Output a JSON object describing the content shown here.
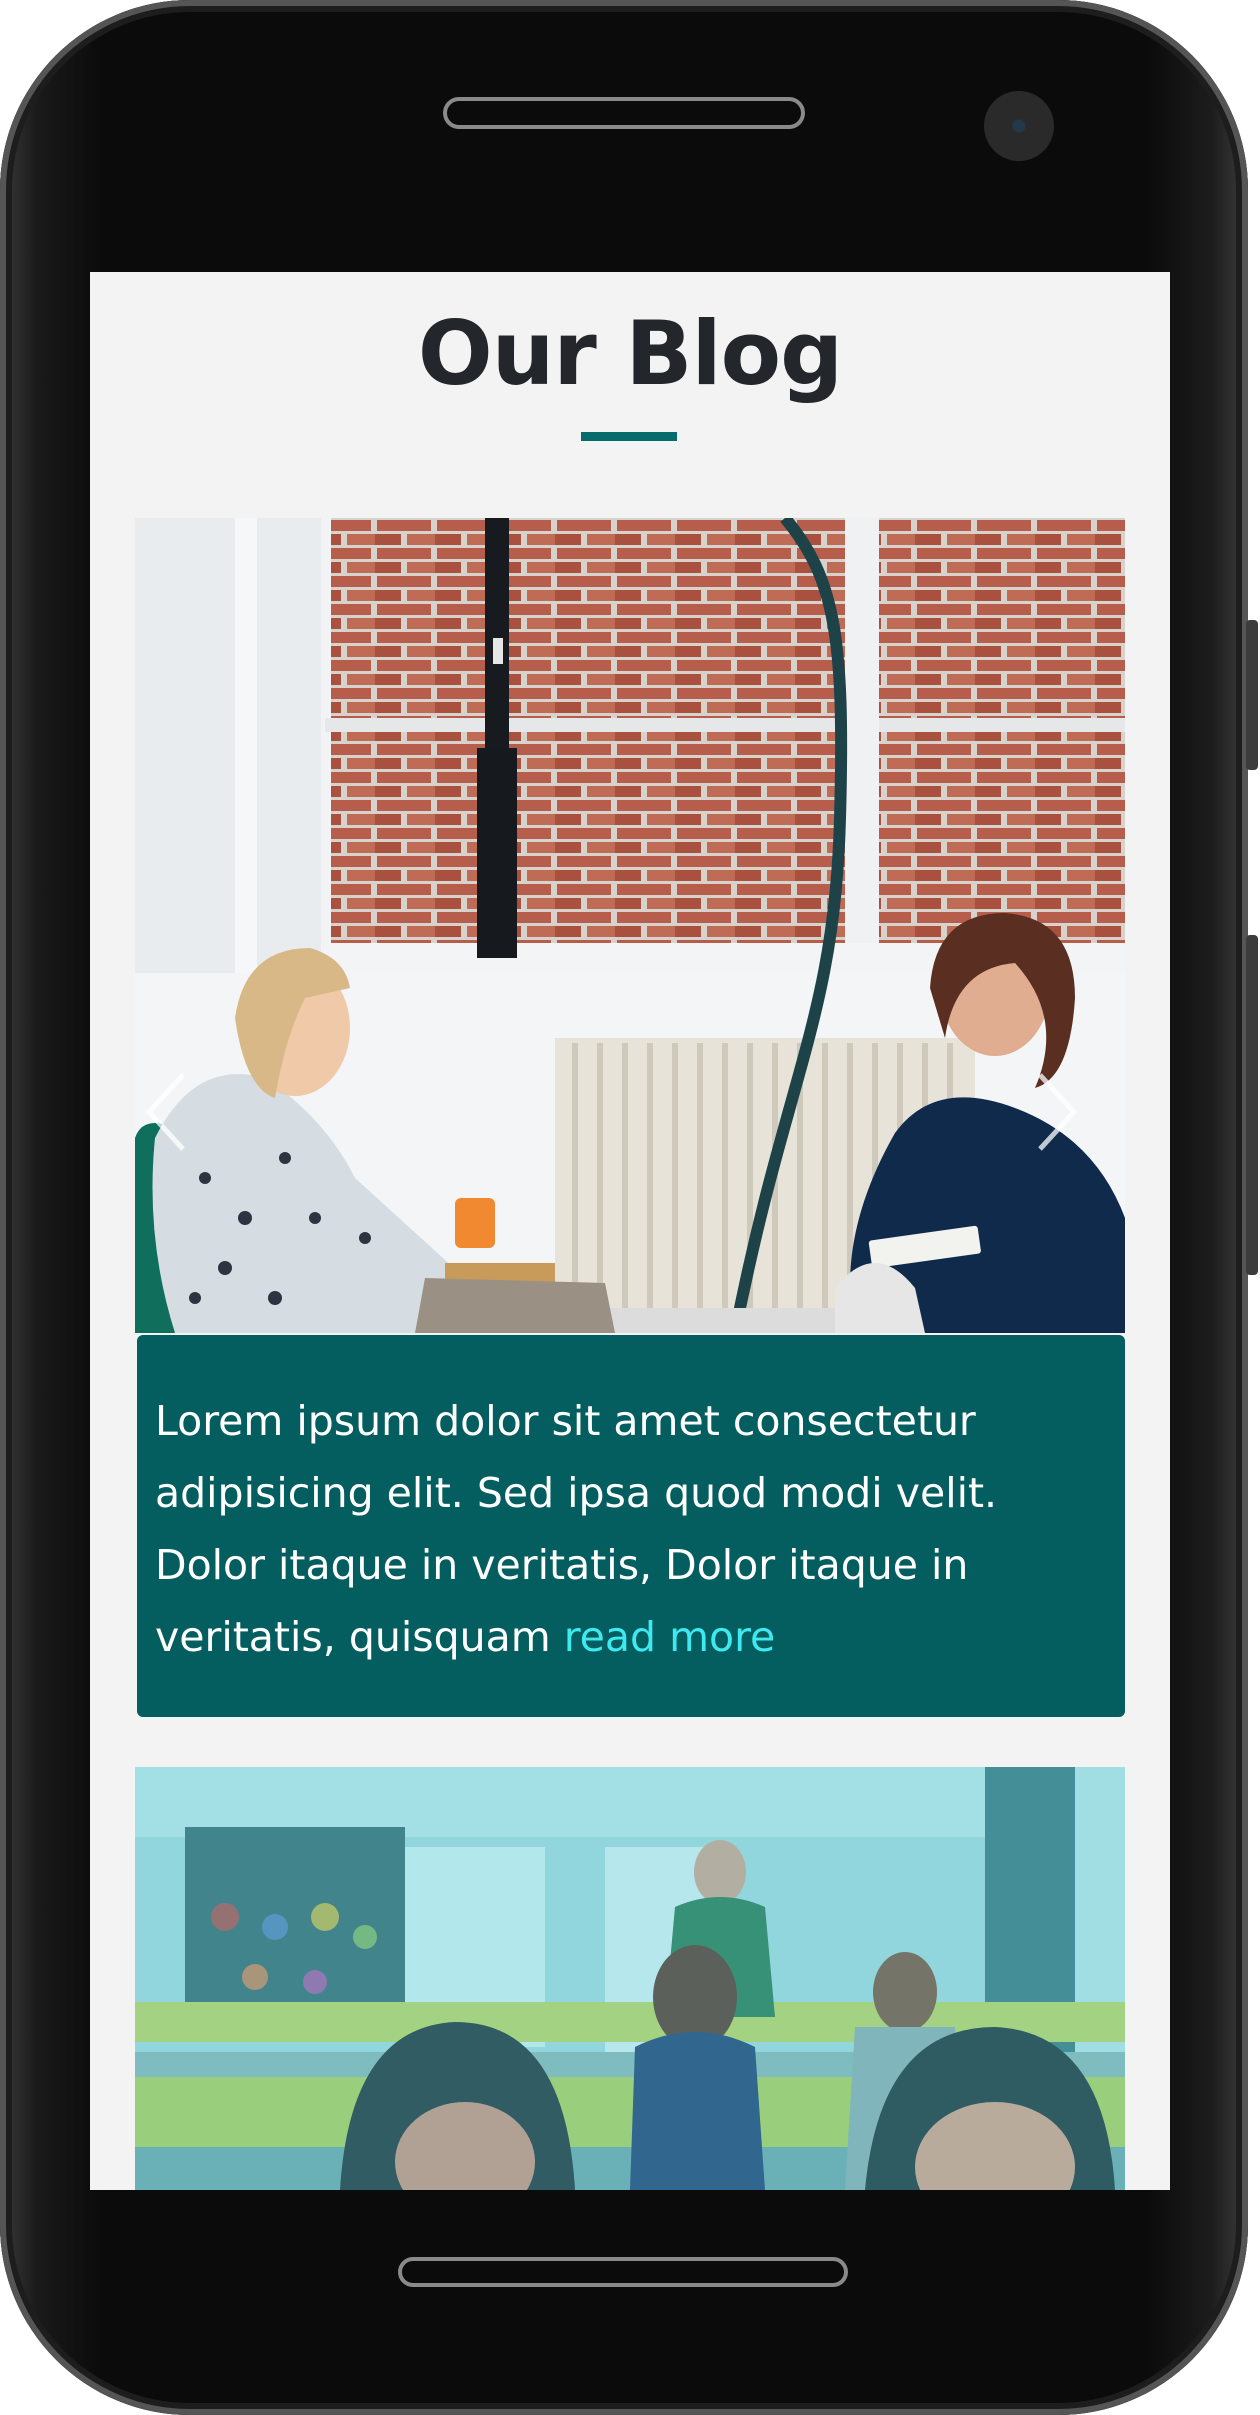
{
  "page": {
    "title": "Our Blog"
  },
  "posts": [
    {
      "image_label": "two women meeting by a brick window",
      "excerpt": "Lorem ipsum dolor sit amet consectetur adipisicing elit. Sed ipsa quod modi velit. Dolor itaque in veritatis, Dolor itaque in veritatis, quisquam ",
      "read_more": "read more"
    },
    {
      "image_label": "office team with teal overlay"
    }
  ],
  "carousel": {
    "prev_icon": "chevron-left-icon",
    "next_icon": "chevron-right-icon"
  },
  "colors": {
    "accent": "#066b6b",
    "caption_bg": "#045e60",
    "link": "#3ee9ef",
    "title": "#23272b",
    "screen_bg": "#f3f3f3"
  }
}
